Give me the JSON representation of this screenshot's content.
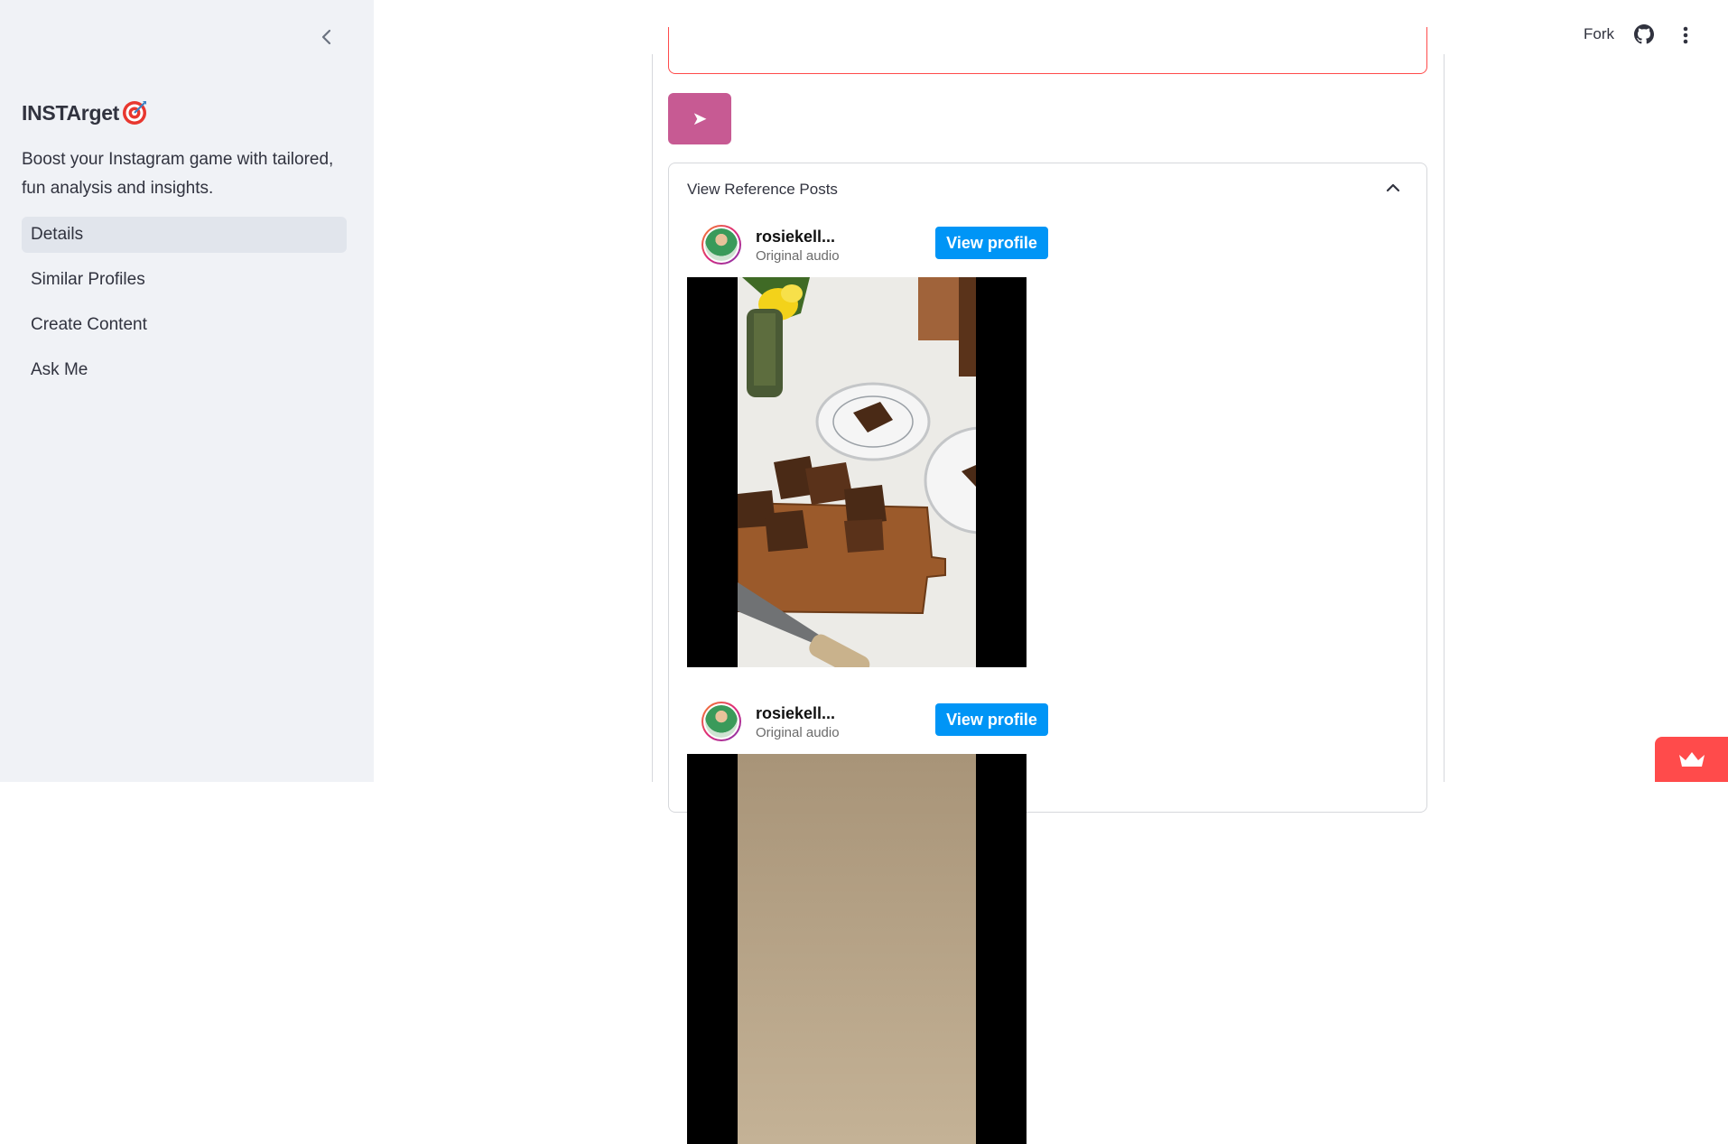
{
  "sidebar": {
    "title": "INSTArget",
    "description": "Boost your Instagram game with tailored, fun analysis and insights.",
    "items": [
      {
        "label": "Details",
        "active": true
      },
      {
        "label": "Similar Profiles"
      },
      {
        "label": "Create Content"
      },
      {
        "label": "Ask Me"
      }
    ]
  },
  "header": {
    "fork_label": "Fork"
  },
  "main": {
    "send_label": "➤",
    "expander_label": "View Reference Posts",
    "posts": [
      {
        "username": "rosiekell...",
        "audio": "Original audio",
        "button": "View profile"
      },
      {
        "username": "rosiekell...",
        "audio": "Original audio",
        "button": "View profile"
      }
    ]
  },
  "colors": {
    "accent": "#c75a93",
    "error_border": "#ff4b4b",
    "instagram_blue": "#0095f6",
    "sidebar_bg": "#f0f2f6"
  }
}
